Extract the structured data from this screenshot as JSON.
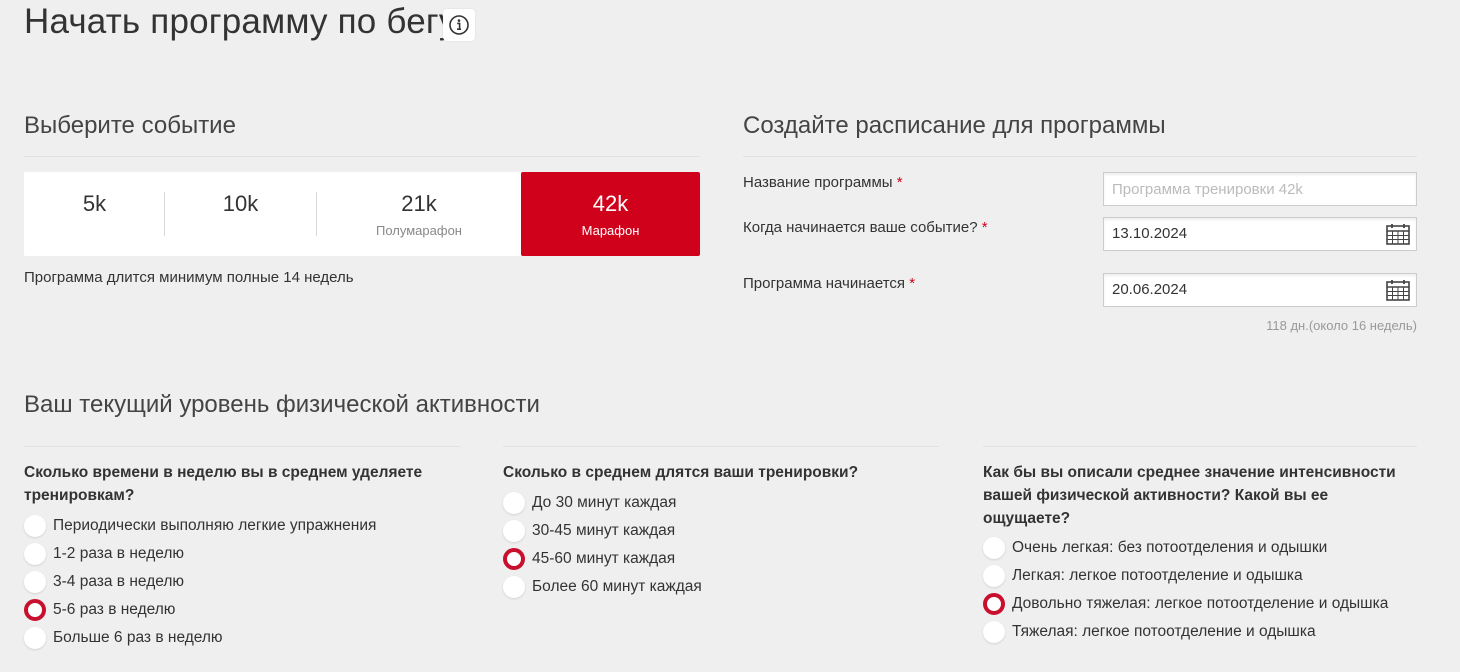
{
  "page": {
    "title": "Начать программу по бегу"
  },
  "event_section": {
    "title": "Выберите событие",
    "events": [
      {
        "distance": "5k",
        "label": ""
      },
      {
        "distance": "10k",
        "label": ""
      },
      {
        "distance": "21k",
        "label": "Полумарафон"
      },
      {
        "distance": "42k",
        "label": "Марафон"
      }
    ],
    "selected": "42k",
    "note": "Программа длится минимум полные 14 недель"
  },
  "schedule_section": {
    "title": "Создайте расписание для программы",
    "name_label": "Название программы",
    "name_placeholder": "Программа тренировки 42k",
    "event_date_label": "Когда начинается ваше событие?",
    "event_date": "13.10.2024",
    "start_date_label": "Программа начинается",
    "start_date": "20.06.2024",
    "required_mark": "*",
    "duration": "118 дн.(около 16 недель)"
  },
  "activity_section": {
    "title": "Ваш текущий уровень физической активности",
    "questions": [
      {
        "title": "Сколько времени в неделю вы в среднем уделяете тренировкам?",
        "options": [
          "Периодически выполняю легкие упражнения",
          "1-2 раза в неделю",
          "3-4 раза в неделю",
          "5-6 раз в неделю",
          "Больше 6 раз в неделю"
        ],
        "selected": "5-6 раз в неделю"
      },
      {
        "title": "Сколько в среднем длятся ваши тренировки?",
        "options": [
          "До 30 минут каждая",
          "30-45 минут каждая",
          "45-60 минут каждая",
          "Более 60 минут каждая"
        ],
        "selected": "45-60 минут каждая"
      },
      {
        "title": "Как бы вы описали среднее значение интенсивности вашей физической активности? Какой вы ее ощущаете?",
        "options": [
          "Очень легкая: без потоотделения и одышки",
          "Легкая: легкое потоотделение и одышка",
          "Довольно тяжелая: легкое потоотделение и одышка",
          "Тяжелая: легкое потоотделение и одышка"
        ],
        "selected": "Довольно тяжелая: легкое потоотделение и одышка"
      }
    ]
  },
  "colors": {
    "accent": "#d0021b",
    "background": "#efefef"
  },
  "icons": {
    "info": "info-icon",
    "calendar": "calendar-icon"
  }
}
